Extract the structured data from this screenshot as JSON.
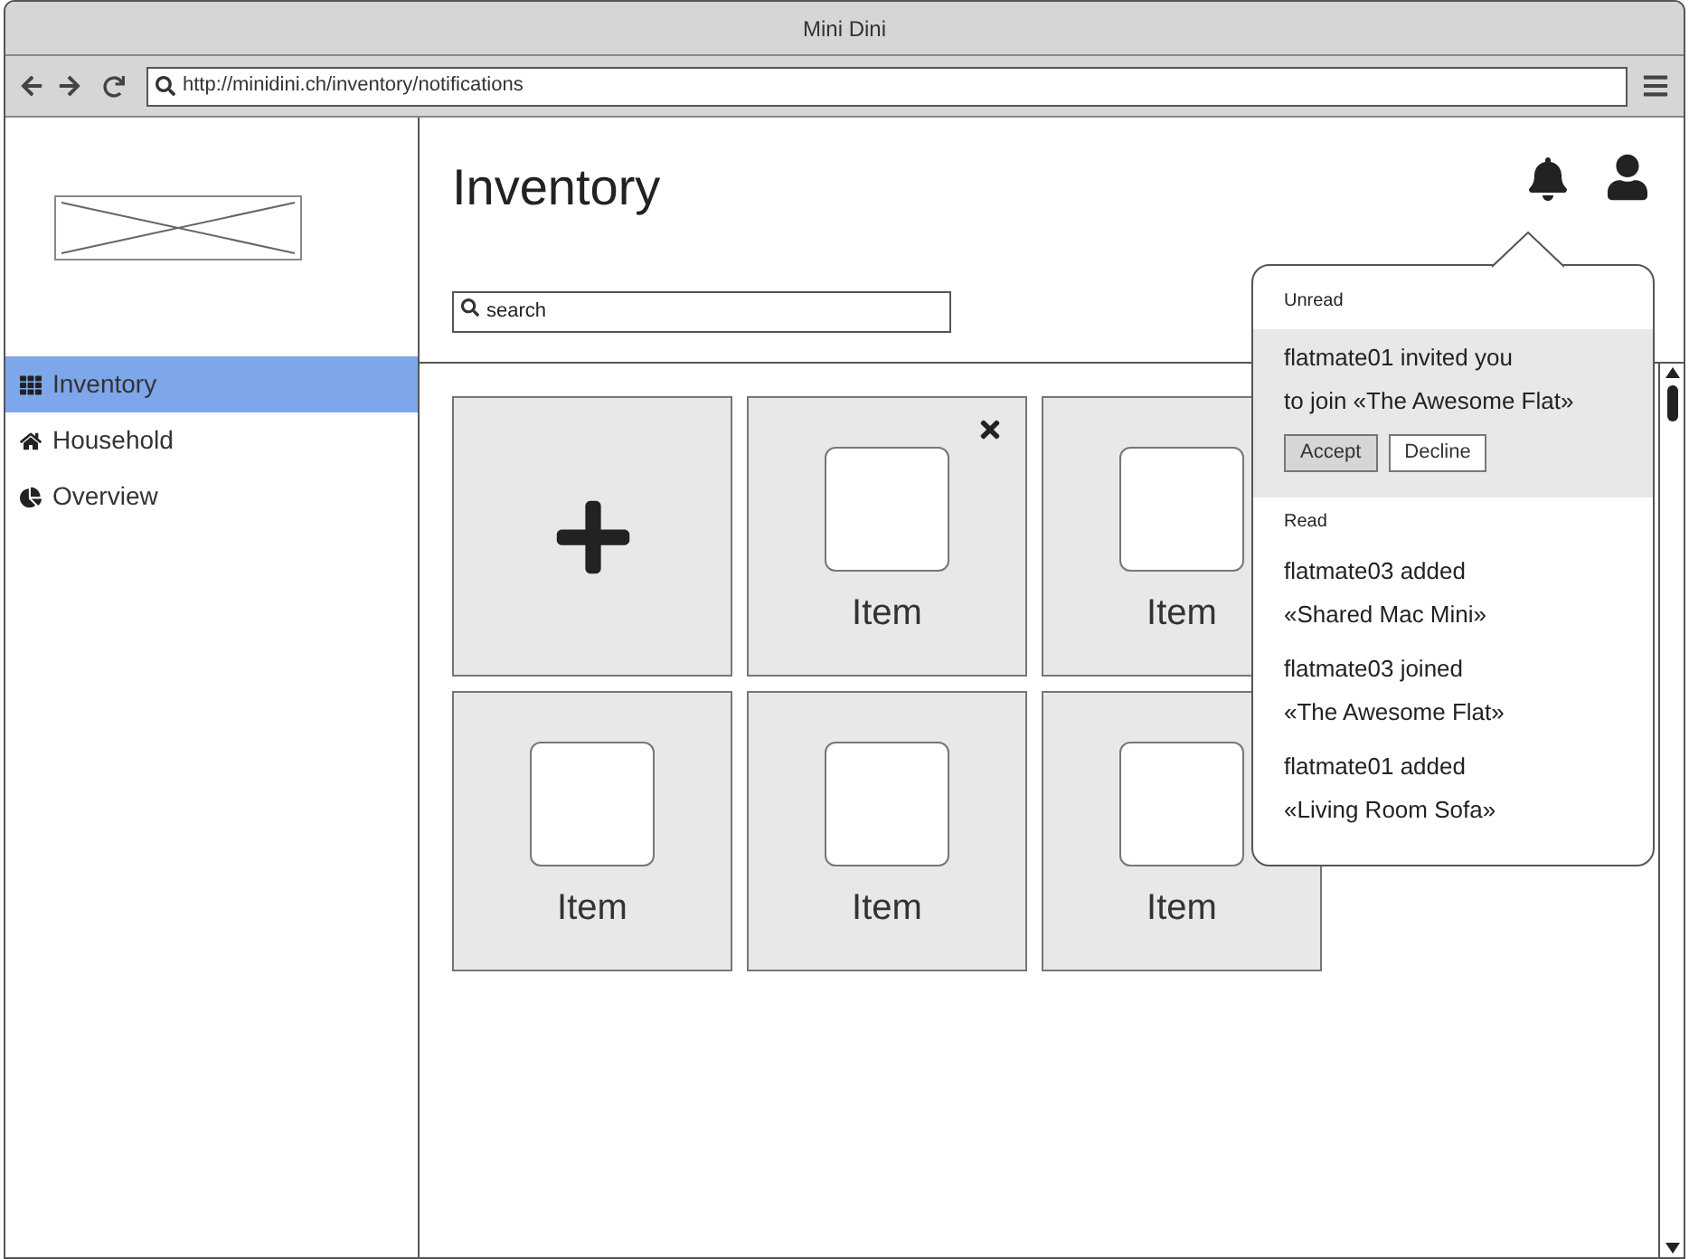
{
  "window": {
    "title": "Mini Dini"
  },
  "address_bar": {
    "url": "http://minidini.ch/inventory/notifications"
  },
  "sidebar": {
    "items": [
      {
        "label": "Inventory",
        "kind": "grid",
        "selected": true
      },
      {
        "label": "Household",
        "kind": "home",
        "selected": false
      },
      {
        "label": "Overview",
        "kind": "pie",
        "selected": false
      }
    ]
  },
  "header": {
    "title": "Inventory",
    "search": {
      "placeholder": "search"
    }
  },
  "tiles": [
    {
      "kind": "add"
    },
    {
      "kind": "item",
      "label": "Item",
      "removable": true
    },
    {
      "kind": "item",
      "label": "Item",
      "removable": false
    },
    {
      "kind": "item",
      "label": "Item",
      "removable": false
    },
    {
      "kind": "item",
      "label": "Item",
      "removable": false
    },
    {
      "kind": "item",
      "label": "Item",
      "removable": false
    }
  ],
  "notifications": {
    "sections": [
      {
        "heading": "Unread",
        "unread": true,
        "items": [
          {
            "lines": [
              "flatmate01 invited you",
              "to join «The Awesome Flat»"
            ],
            "actions": [
              {
                "label": "Accept",
                "selected": true
              },
              {
                "label": "Decline",
                "selected": false
              }
            ]
          }
        ]
      },
      {
        "heading": "Read",
        "unread": false,
        "items": [
          {
            "lines": [
              "flatmate03 added",
              "«Shared Mac Mini»"
            ]
          },
          {
            "lines": [
              "flatmate03 joined",
              "«The Awesome Flat»"
            ]
          },
          {
            "lines": [
              "flatmate01 added",
              "«Living Room Sofa»"
            ]
          }
        ]
      }
    ]
  }
}
